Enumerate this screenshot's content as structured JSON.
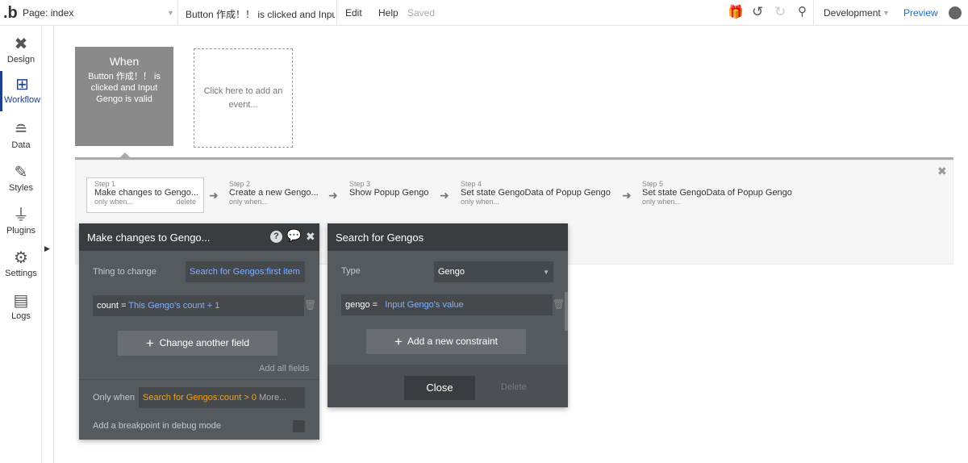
{
  "topbar": {
    "logo": ".b",
    "page": "Page: index",
    "event": "Button 作成！！ is clicked and Input...",
    "edit": "Edit",
    "help": "Help",
    "saved": "Saved",
    "env": "Development",
    "preview": "Preview"
  },
  "sidebar": {
    "items": [
      {
        "label": "Design",
        "icon": "design-icon"
      },
      {
        "label": "Workflow",
        "icon": "workflow-icon"
      },
      {
        "label": "Data",
        "icon": "database-icon"
      },
      {
        "label": "Styles",
        "icon": "brush-icon"
      },
      {
        "label": "Plugins",
        "icon": "plug-icon"
      },
      {
        "label": "Settings",
        "icon": "gear-icon"
      },
      {
        "label": "Logs",
        "icon": "document-icon"
      }
    ]
  },
  "event": {
    "title": "When",
    "desc": "Button 作成！！ is clicked and Input Gengo is valid",
    "add": "Click here to add an event..."
  },
  "steps": [
    {
      "step": "Step 1",
      "title": "Make changes to Gengo...",
      "only": "only when...",
      "delete": "delete"
    },
    {
      "step": "Step 2",
      "title": "Create a new Gengo...",
      "only": "only when..."
    },
    {
      "step": "Step 3",
      "title": "Show Popup Gengo",
      "only": ""
    },
    {
      "step": "Step 4",
      "title": "Set state GengoData of Popup Gengo",
      "only": "only when..."
    },
    {
      "step": "Step 5",
      "title": "Set state GengoData of Popup Gengo",
      "only": "only when..."
    }
  ],
  "action_panel": {
    "title": "Make changes to Gengo...",
    "thing_label": "Thing to change",
    "thing_value": "Search for Gengos:first item",
    "field_name": "count",
    "field_eq": "=",
    "field_value": "This Gengo's count + 1",
    "change_another": "Change another field",
    "add_all": "Add all fields",
    "only_when_label": "Only when",
    "only_when_value": "Search for Gengos:count > 0",
    "more": "More...",
    "breakpoint": "Add a breakpoint in debug mode"
  },
  "search_panel": {
    "title": "Search for Gengos",
    "type_label": "Type",
    "type_value": "Gengo",
    "constraint_key": "gengo =",
    "constraint_value": "Input Gengo's value",
    "add_constraint": "Add a new constraint",
    "close": "Close",
    "delete": "Delete"
  }
}
